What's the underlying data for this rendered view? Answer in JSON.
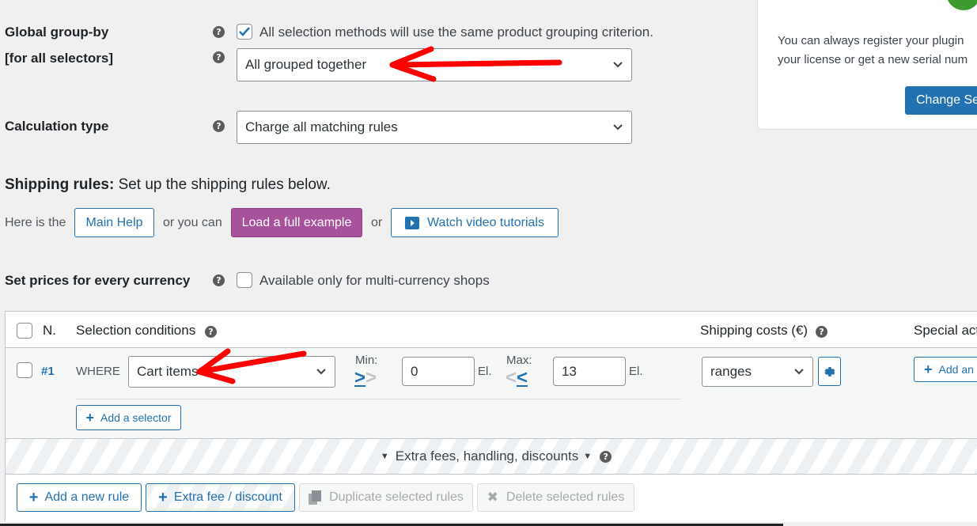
{
  "settings": {
    "global_group_by": {
      "label": "Global group-by",
      "sublabel": "[for all selectors]",
      "checkbox_checked": true,
      "checkbox_label": "All selection methods will use the same product grouping criterion.",
      "select_value": "All grouped together"
    },
    "calculation_type": {
      "label": "Calculation type",
      "select_value": "Charge all matching rules"
    }
  },
  "license_panel": {
    "text_line1": "You can always register your plugin",
    "text_line2": "your license or get a new serial num",
    "button_label": "Change Se",
    "status_color": "#3c9a2f"
  },
  "shipping_rules": {
    "title": "Shipping rules:",
    "subtitle": "Set up the shipping rules below.",
    "help_prefix": "Here is the",
    "main_help_label": "Main Help",
    "or_you_can": "or you can",
    "load_example_label": "Load a full example",
    "or": "or",
    "video_label": "Watch video tutorials"
  },
  "currency": {
    "label": "Set prices for every currency",
    "checkbox_checked": false,
    "checkbox_label": "Available only for multi-currency shops"
  },
  "table": {
    "headers": {
      "number": "N.",
      "conditions": "Selection conditions",
      "costs": "Shipping costs (€)",
      "special": "Special act"
    },
    "rows": [
      {
        "number": "#1",
        "where": "WHERE",
        "selector": "Cart items",
        "min_label": "Min:",
        "min_value": "0",
        "min_unit": "El.",
        "max_label": "Max:",
        "max_value": "13",
        "max_unit": "El.",
        "cost_type": "ranges",
        "add_selector_label": "Add a selector",
        "special_action_label": "Add an"
      }
    ],
    "extra_fees_label": "Extra fees, handling, discounts"
  },
  "footer_buttons": {
    "add_rule": "Add a new rule",
    "extra_fee": "Extra fee / discount",
    "duplicate": "Duplicate selected rules",
    "delete": "Delete selected rules"
  },
  "colors": {
    "accent": "#2271b1",
    "purple": "#a8529b",
    "annotation": "#ff0000"
  }
}
